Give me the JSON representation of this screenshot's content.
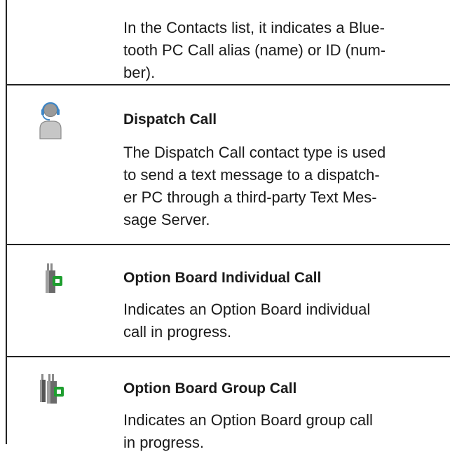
{
  "rows": [
    {
      "icon": "",
      "title": "",
      "description": "In the Contacts list, it indicates a Blue-\ntooth PC Call alias (name) or ID (num-\nber)."
    },
    {
      "icon": "dispatch-call-icon",
      "title": "Dispatch Call",
      "description": "The Dispatch Call contact type is used\nto send a text message to a dispatch-\ner PC through a third-party Text Mes-\nsage Server."
    },
    {
      "icon": "option-board-individual-call-icon",
      "title": "Option Board Individual Call",
      "description": "Indicates an Option Board individual\ncall in progress."
    },
    {
      "icon": "option-board-group-call-icon",
      "title": "Option Board Group Call",
      "description": "Indicates an Option Board group call\nin progress."
    }
  ],
  "colors": {
    "rule": "#222222",
    "icon_gray": "#9a9a9a",
    "icon_dark": "#5f5f5f",
    "indicator_green": "#1e9e2f",
    "headset_blue": "#3e86c6"
  }
}
